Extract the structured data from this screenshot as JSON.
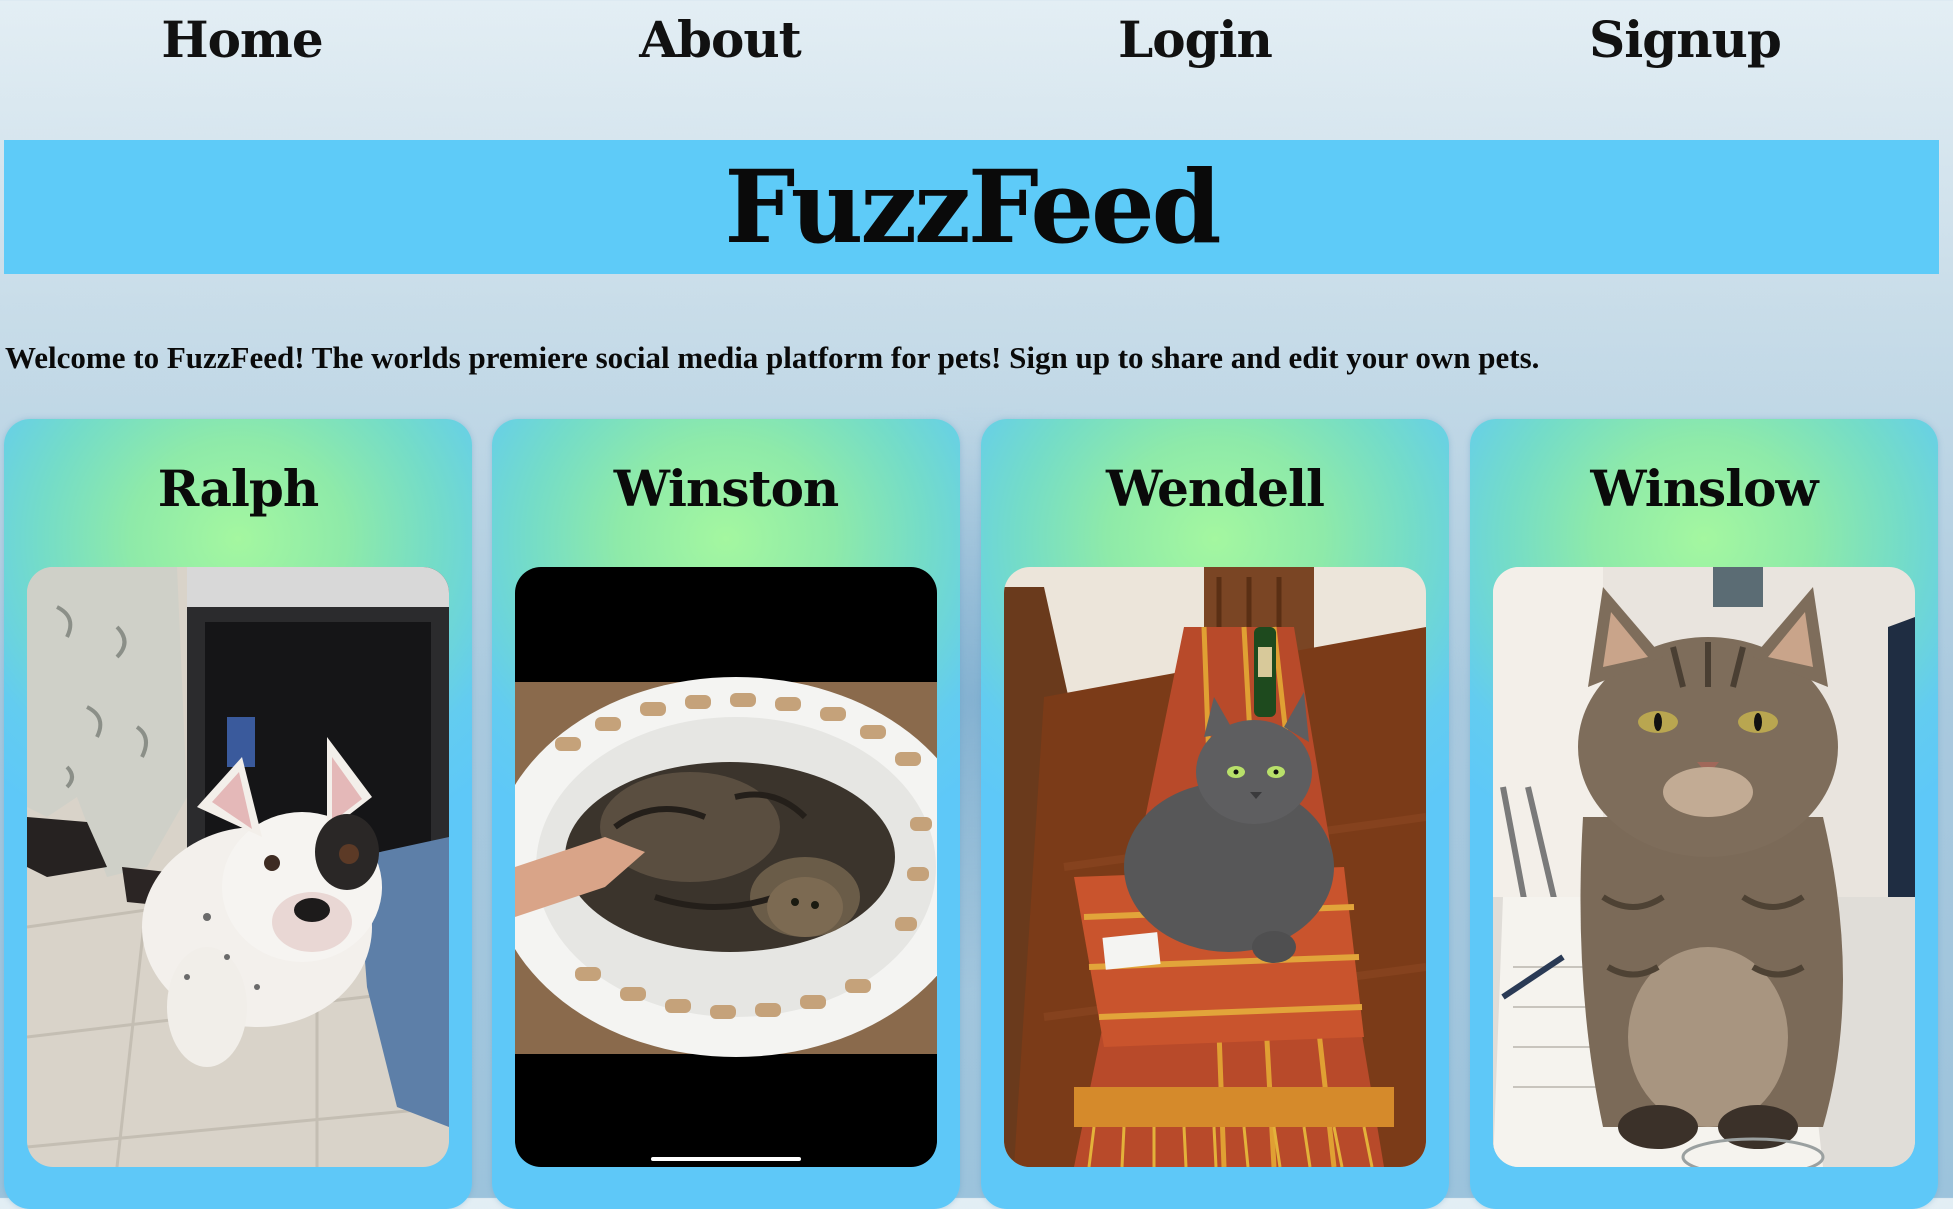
{
  "nav": {
    "items": [
      {
        "label": "Home"
      },
      {
        "label": "About"
      },
      {
        "label": "Login"
      },
      {
        "label": "Signup"
      }
    ]
  },
  "header": {
    "title": "FuzzFeed"
  },
  "welcome": {
    "text": "Welcome to FuzzFeed! The worlds premiere social media platform for pets! Sign up to share and edit your own pets."
  },
  "pets": [
    {
      "name": "Ralph"
    },
    {
      "name": "Winston"
    },
    {
      "name": "Wendell"
    },
    {
      "name": "Winslow"
    }
  ],
  "colors": {
    "banner": "#5ecbf8",
    "card_center": "#a4f7a0",
    "card_edge": "#5ec8f8"
  }
}
